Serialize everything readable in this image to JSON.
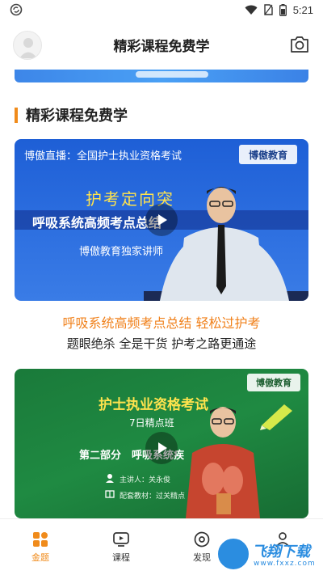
{
  "status_bar": {
    "time": "5:21"
  },
  "header": {
    "title": "精彩课程免费学"
  },
  "section": {
    "title": "精彩课程免费学"
  },
  "courses": [
    {
      "video": {
        "top_text": "博傲直播：全国护士执业资格考试",
        "logo_text": "博傲教育",
        "headline": "护考定向突",
        "subtitle": "呼吸系统高频考点总结",
        "footer_text": "博傲教育独家讲师"
      },
      "title": "呼吸系统高频考点总结 轻松过护考",
      "description": "题眼绝杀 全是干货 护考之路更通途"
    },
    {
      "video": {
        "logo_text": "博傲教育",
        "headline": "护士执业资格考试",
        "subtitle": "7日精点班",
        "part_text": "第二部分　呼吸系统疾",
        "presenter_line": "主讲人：关永俊",
        "material_line": "配套教材：过关精点"
      }
    }
  ],
  "bottom_nav": {
    "items": [
      {
        "label": "金题",
        "icon": "grid-icon",
        "active": true
      },
      {
        "label": "课程",
        "icon": "video-course-icon",
        "active": false
      },
      {
        "label": "发现",
        "icon": "compass-icon",
        "active": false
      },
      {
        "label": "",
        "icon": "profile-icon",
        "active": false
      }
    ]
  },
  "watermark": {
    "text": "飞翔下载",
    "sub": "www.fxxz.com"
  },
  "colors": {
    "accent": "#f08b1b",
    "video1_bg": "#2d6fe0",
    "video2_bg": "#1f8a42",
    "course_title": "#f0801a"
  }
}
